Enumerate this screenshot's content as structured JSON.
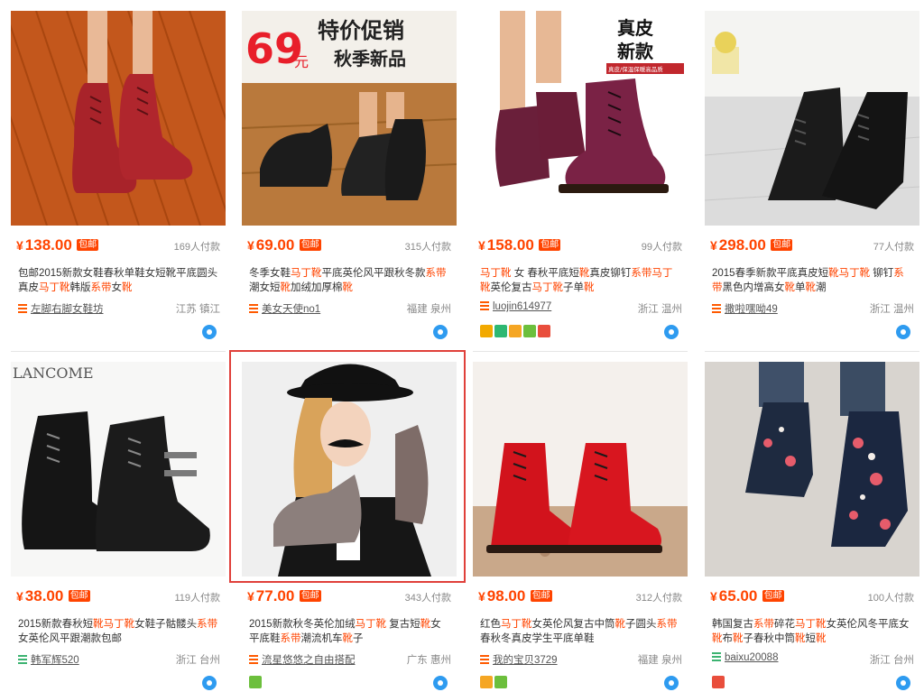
{
  "products": [
    {
      "price": "138.00",
      "paid": "169人付款",
      "title": [
        {
          "t": "包邮2015新款女鞋春秋单鞋女短靴平底圆头真皮"
        },
        {
          "t": "马丁靴",
          "h": true
        },
        {
          "t": "韩版"
        },
        {
          "t": "系带",
          "h": true
        },
        {
          "t": "女"
        },
        {
          "t": "靴",
          "h": true
        }
      ],
      "shop": "左脚右脚女鞋坊",
      "location": "江苏 镇江",
      "badges": []
    },
    {
      "price": "69.00",
      "paid": "315人付款",
      "title": [
        {
          "t": "冬季女鞋"
        },
        {
          "t": "马丁靴",
          "h": true
        },
        {
          "t": "平底英伦风平跟秋冬款"
        },
        {
          "t": "系带",
          "h": true
        },
        {
          "t": "潮女短"
        },
        {
          "t": "靴",
          "h": true
        },
        {
          "t": "加绒加厚棉"
        },
        {
          "t": "靴",
          "h": true
        }
      ],
      "shop": "美女天使no1",
      "location": "福建 泉州",
      "badges": [],
      "banner_big": "69",
      "banner_unit": "元",
      "banner_top": "特价促销",
      "banner_bottom": "秋季新品"
    },
    {
      "price": "158.00",
      "paid": "99人付款",
      "title": [
        {
          "t": "马丁靴",
          "h": true
        },
        {
          "t": " 女 春秋平底短"
        },
        {
          "t": "靴",
          "h": true
        },
        {
          "t": "真皮铆钉"
        },
        {
          "t": "系带",
          "h": true
        },
        {
          "t": ""
        },
        {
          "t": "马丁靴",
          "h": true
        },
        {
          "t": "英伦复古"
        },
        {
          "t": "马丁靴",
          "h": true
        },
        {
          "t": "子单"
        },
        {
          "t": "靴",
          "h": true
        }
      ],
      "shop": "luojin614977",
      "location": "浙江 温州",
      "badges": [
        "#f2a900",
        "#2eb872",
        "#f5a623",
        "#6cbf3c",
        "#e94e3c"
      ],
      "banner_top": "真皮",
      "banner_bottom": "新款",
      "banner_sub": "真皮/保温保暖高品质"
    },
    {
      "price": "298.00",
      "paid": "77人付款",
      "title": [
        {
          "t": "2015春季新款平底真皮短"
        },
        {
          "t": "靴",
          "h": true
        },
        {
          "t": ""
        },
        {
          "t": "马丁靴",
          "h": true
        },
        {
          "t": " 铆钉"
        },
        {
          "t": "系带",
          "h": true
        },
        {
          "t": "黑色内增高女"
        },
        {
          "t": "靴",
          "h": true
        },
        {
          "t": "单"
        },
        {
          "t": "靴",
          "h": true
        },
        {
          "t": "潮"
        }
      ],
      "shop": "撒啦嘿呦49",
      "location": "浙江 温州",
      "badges": []
    },
    {
      "price": "38.00",
      "paid": "119人付款",
      "title": [
        {
          "t": "2015新款春秋短"
        },
        {
          "t": "靴",
          "h": true
        },
        {
          "t": ""
        },
        {
          "t": "马丁靴",
          "h": true
        },
        {
          "t": "女鞋子骷髅头"
        },
        {
          "t": "系带",
          "h": true
        },
        {
          "t": "女英伦风平跟潮款包邮"
        }
      ],
      "shop": "韩军辉520",
      "location": "浙江 台州",
      "badges": [],
      "shop_green": true,
      "banner_brand": "LANCOME"
    },
    {
      "price": "77.00",
      "paid": "343人付款",
      "title": [
        {
          "t": "2015新款秋冬英伦加绒"
        },
        {
          "t": "马丁靴",
          "h": true
        },
        {
          "t": " 复古短"
        },
        {
          "t": "靴",
          "h": true
        },
        {
          "t": "女平底鞋"
        },
        {
          "t": "系带",
          "h": true
        },
        {
          "t": "潮流机车"
        },
        {
          "t": "靴",
          "h": true
        },
        {
          "t": "子"
        }
      ],
      "shop": "流星悠悠之自由搭配",
      "location": "广东 惠州",
      "badges": [
        "#6cbf3c"
      ]
    },
    {
      "price": "98.00",
      "paid": "312人付款",
      "title": [
        {
          "t": "红色"
        },
        {
          "t": "马丁靴",
          "h": true
        },
        {
          "t": "女英伦风复古中筒"
        },
        {
          "t": "靴",
          "h": true
        },
        {
          "t": "子圆头"
        },
        {
          "t": "系带",
          "h": true
        },
        {
          "t": "春秋冬真皮学生平底单鞋"
        }
      ],
      "shop": "我的宝贝3729",
      "location": "福建 泉州",
      "badges": [
        "#f5a623",
        "#6cbf3c"
      ]
    },
    {
      "price": "65.00",
      "paid": "100人付款",
      "title": [
        {
          "t": "韩国复古"
        },
        {
          "t": "系带",
          "h": true
        },
        {
          "t": "碎花"
        },
        {
          "t": "马丁靴",
          "h": true
        },
        {
          "t": "女英伦风冬平底女"
        },
        {
          "t": "靴",
          "h": true
        },
        {
          "t": "布"
        },
        {
          "t": "靴",
          "h": true
        },
        {
          "t": "子春秋中筒"
        },
        {
          "t": "靴",
          "h": true
        },
        {
          "t": "短"
        },
        {
          "t": "靴",
          "h": true
        }
      ],
      "shop": "baixu20088",
      "location": "浙江 台州",
      "badges": [
        "#e94e3c"
      ],
      "shop_green": true
    }
  ],
  "labels": {
    "currency": "¥",
    "free_shipping": "包邮"
  },
  "colors": {
    "price": "#ff4400",
    "selection": "#e0403a",
    "wangwang": "#2e9bf0"
  }
}
